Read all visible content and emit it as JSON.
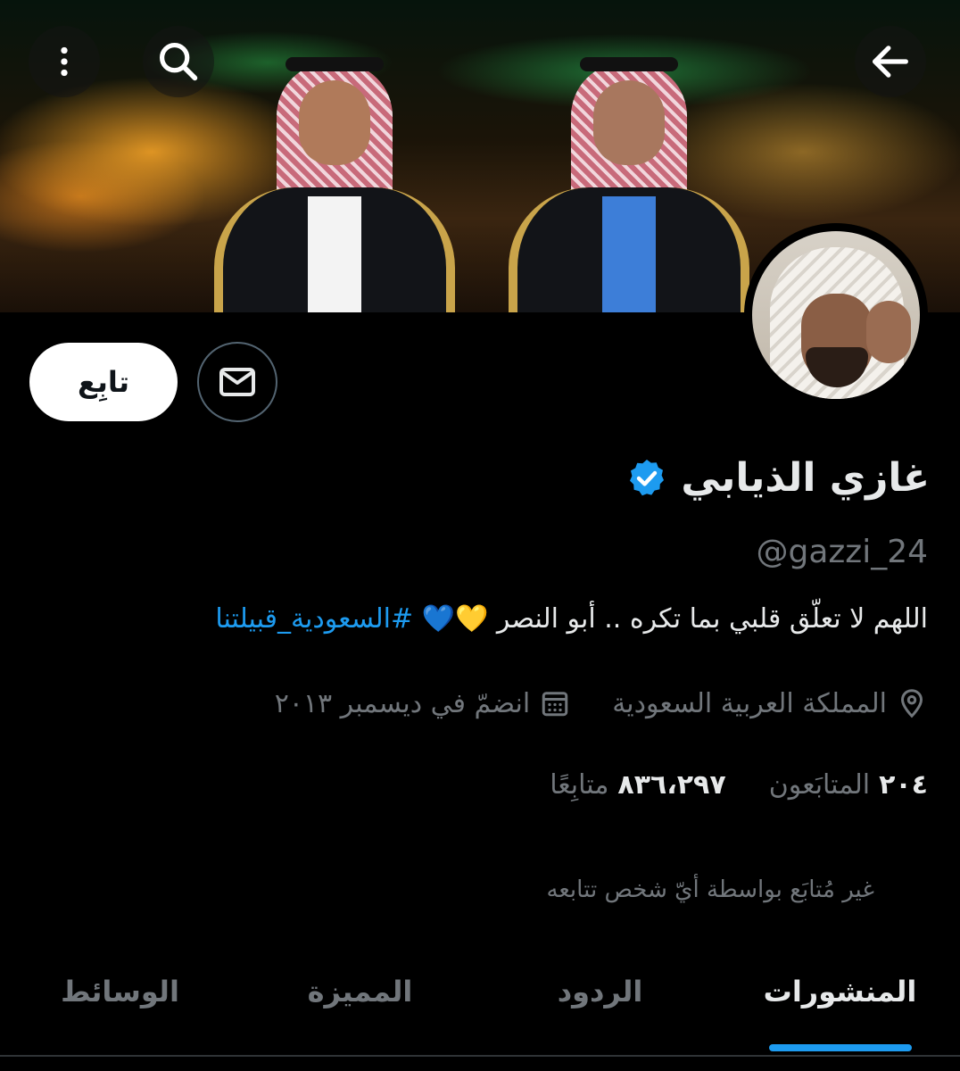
{
  "colors": {
    "background": "#000000",
    "accent": "#1d9bf0",
    "text_primary": "#e7e9ea",
    "text_secondary": "#71767b",
    "verified_badge": "#1d9bf0"
  },
  "header": {
    "back_icon": "arrow-left-icon",
    "search_icon": "search-icon",
    "menu_icon": "more-vertical-icon"
  },
  "profile": {
    "display_name": "غازي الذيابي",
    "verified": true,
    "handle": "@gazzi_24",
    "bio_text": "اللهم لا تعلّق قلبي بما تكره .. أبو النصر",
    "bio_emojis": "💛💙",
    "bio_hashtag": "#السعودية_قبيلتنا",
    "location": "المملكة العربية السعودية",
    "joined": "انضمّ في ديسمبر ٢٠١٣",
    "following_count": "٢٠٤",
    "following_label": "المتابَعون",
    "followers_count": "٨٣٦،٢٩٧",
    "followers_label": "متابِعًا",
    "not_followed_note": "غير مُتابَع بواسطة أيّ شخص تتابعه"
  },
  "actions": {
    "follow_label": "تابِع",
    "message_icon": "mail-icon"
  },
  "tabs": [
    {
      "label": "المنشورات",
      "active": true
    },
    {
      "label": "الردود",
      "active": false
    },
    {
      "label": "المميزة",
      "active": false
    },
    {
      "label": "الوسائط",
      "active": false
    }
  ]
}
